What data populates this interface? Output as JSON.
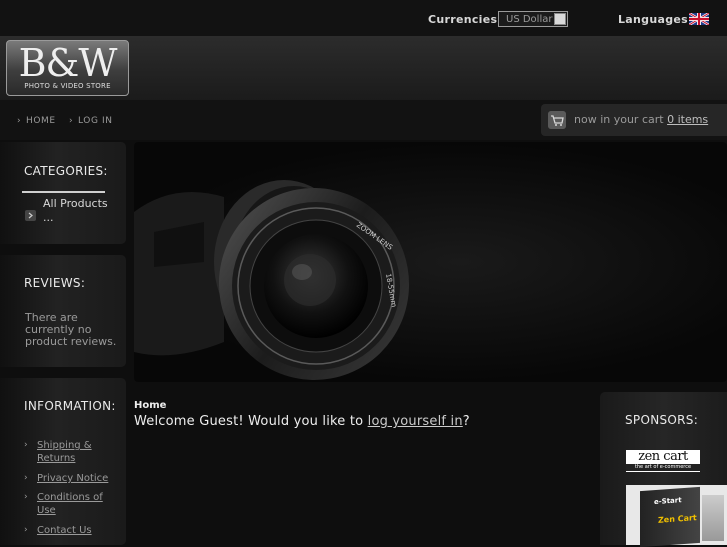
{
  "topbar": {
    "currencies_label": "Currencies:",
    "currency_selected": "US Dollar",
    "languages_label": "Languages:"
  },
  "logo": {
    "text": "B&W",
    "subtitle": "PHOTO & VIDEO STORE"
  },
  "nav": {
    "home": "HOME",
    "login": "LOG IN"
  },
  "cart": {
    "prefix": "now in your cart",
    "items_link": "0 items"
  },
  "categories": {
    "title": "CATEGORIES:",
    "items": [
      {
        "label": "All Products ..."
      }
    ]
  },
  "reviews": {
    "title": "REVIEWS:",
    "text": "There are currently no product reviews."
  },
  "information": {
    "title": "INFORMATION:",
    "links": [
      {
        "label": "Shipping & Returns"
      },
      {
        "label": "Privacy Notice"
      },
      {
        "label": "Conditions of Use"
      },
      {
        "label": "Contact Us"
      }
    ]
  },
  "main": {
    "breadcrumb": "Home",
    "welcome_prefix": "Welcome Guest! Would you like to",
    "welcome_link": "log yourself in",
    "welcome_suffix": "?"
  },
  "lens": {
    "brand": "ZOOM LENS",
    "spec": "18-55mm"
  },
  "sponsors": {
    "title": "SPONSORS:",
    "zencart_logo": "zen cart",
    "zencart_tagline": "the art of e-commerce",
    "book_title": "e-Start",
    "book_subtitle": "Zen Cart"
  },
  "colors": {
    "background": "#0e0e0e",
    "panel": "#222222",
    "text": "#dddddd",
    "link": "#9a9a9a"
  }
}
